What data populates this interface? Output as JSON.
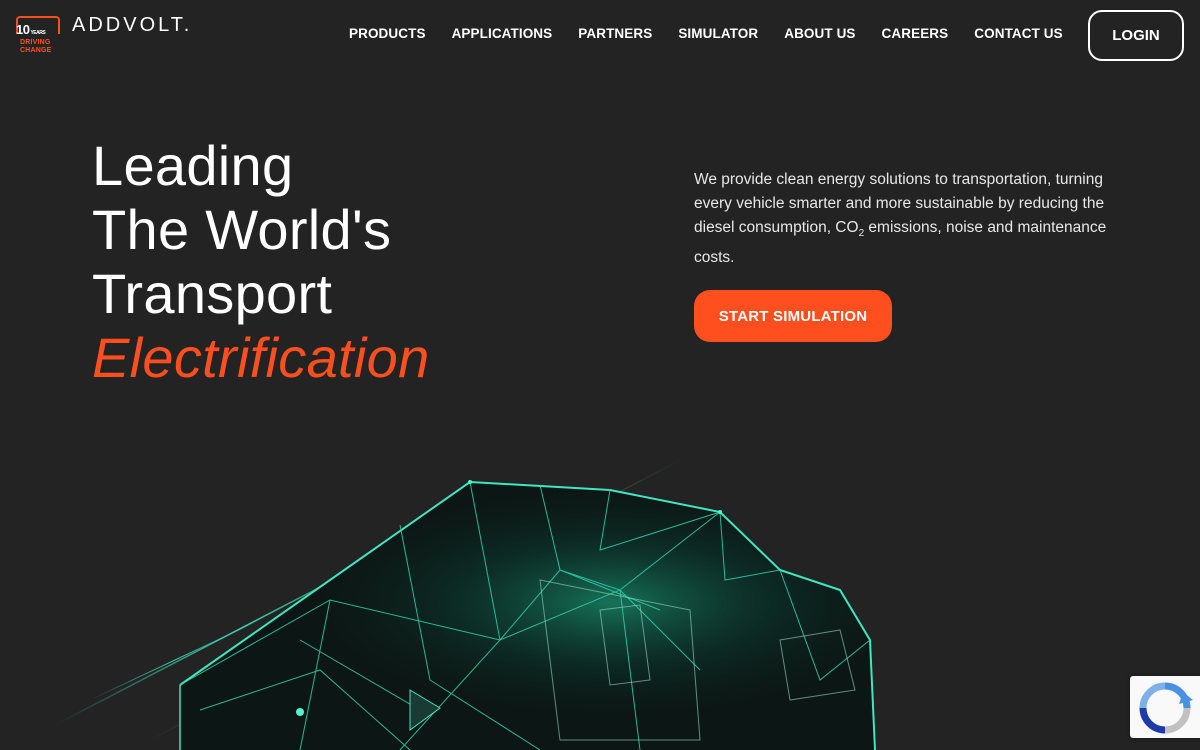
{
  "brand": {
    "badge_number": "10",
    "badge_years": "YEARS",
    "badge_line1": "DRIVING",
    "badge_line2": "CHANGE",
    "wordmark": "ADDVOLT.",
    "accent_color": "#ff4f1f"
  },
  "nav": {
    "items": [
      {
        "label": "PRODUCTS"
      },
      {
        "label": "APPLICATIONS"
      },
      {
        "label": "PARTNERS"
      },
      {
        "label": "SIMULATOR"
      },
      {
        "label": "ABOUT US"
      },
      {
        "label": "CAREERS"
      },
      {
        "label": "CONTACT US"
      }
    ],
    "login_label": "LOGIN"
  },
  "hero": {
    "headline_line1": "Leading",
    "headline_line2": "The World's",
    "headline_line3": "Transport",
    "headline_accent": "Electrification",
    "lead_part1": "We provide clean energy solutions to transportation, turning every vehicle smarter and more sustainable by reducing the diesel consumption, CO",
    "lead_sub": "2",
    "lead_part2": " emissions, noise and maintenance costs.",
    "cta_label": "START SIMULATION"
  },
  "widgets": {
    "recaptcha_icon": "recaptcha-icon"
  }
}
